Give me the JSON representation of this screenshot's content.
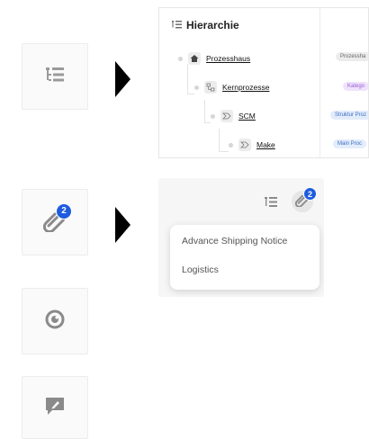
{
  "hierarchy": {
    "title": "Hierarchie",
    "nodes": [
      {
        "label": "Prozesshaus"
      },
      {
        "label": "Kernprozesse"
      },
      {
        "label": "SCM"
      },
      {
        "label": "Make"
      }
    ],
    "chips": [
      {
        "label": "Prozessha",
        "bg": "#ececec",
        "fg": "#666"
      },
      {
        "label": "Katego",
        "bg": "#efe3fb",
        "fg": "#9a5cd6"
      },
      {
        "label": "Struktur Proz",
        "bg": "#e2ecfb",
        "fg": "#3f6fc4"
      },
      {
        "label": "Main Proc",
        "bg": "#e2ecfb",
        "fg": "#3f6fc4"
      }
    ]
  },
  "badge_count": "2",
  "menu": {
    "items": [
      {
        "label": "Advance Shipping Notice"
      },
      {
        "label": "Logistics"
      }
    ]
  },
  "colors": {
    "accent": "#1d5be0",
    "icon": "#8a8a8a"
  }
}
